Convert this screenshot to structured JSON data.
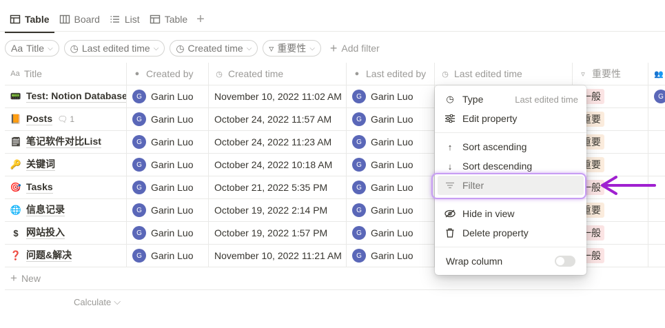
{
  "views": {
    "tabs": [
      {
        "label": "Table",
        "icon": "table-icon",
        "active": true
      },
      {
        "label": "Board",
        "icon": "board-icon",
        "active": false
      },
      {
        "label": "List",
        "icon": "list-icon",
        "active": false
      },
      {
        "label": "Table",
        "icon": "table-icon",
        "active": false
      }
    ],
    "add_label": "+"
  },
  "filters": {
    "chips": [
      {
        "icon_text": "Aa",
        "label": "Title"
      },
      {
        "icon_text": "◷",
        "label": "Last edited time"
      },
      {
        "icon_text": "◷",
        "label": "Created time"
      },
      {
        "icon_text": "▿",
        "label": "重要性"
      }
    ],
    "add_filter_label": "Add filter"
  },
  "table": {
    "columns": [
      {
        "icon_text": "Aa",
        "label": "Title"
      },
      {
        "icon_text": "●",
        "label": "Created by"
      },
      {
        "icon_text": "◷",
        "label": "Created time"
      },
      {
        "icon_text": "●",
        "label": "Last edited by"
      },
      {
        "icon_text": "◷",
        "label": "Last edited time"
      },
      {
        "icon_text": "▿",
        "label": "重要性"
      },
      {
        "icon_text": "👥",
        "label": ""
      }
    ],
    "rows": [
      {
        "icon": "📟",
        "title": "Test: Notion Database",
        "comments": "",
        "created_by": "Garin Luo",
        "created_time": "November 10, 2022 11:02 AM",
        "last_edited_by": "Garin Luo",
        "importance": "一般",
        "importance_color": "red",
        "extra_avatar": "G"
      },
      {
        "icon": "📙",
        "title": "Posts",
        "comments": "1",
        "created_by": "Garin Luo",
        "created_time": "October 24, 2022 11:57 AM",
        "last_edited_by": "Garin Luo",
        "importance": "重要",
        "importance_color": "orange",
        "extra_avatar": ""
      },
      {
        "icon": "🗒",
        "title": "笔记软件对比List",
        "comments": "",
        "created_by": "Garin Luo",
        "created_time": "October 24, 2022 11:23 AM",
        "last_edited_by": "Garin Luo",
        "importance": "重要",
        "importance_color": "orange",
        "extra_avatar": ""
      },
      {
        "icon": "🔑",
        "title": "关键词",
        "comments": "",
        "created_by": "Garin Luo",
        "created_time": "October 24, 2022 10:18 AM",
        "last_edited_by": "Garin Luo",
        "importance": "重要",
        "importance_color": "orange",
        "extra_avatar": ""
      },
      {
        "icon": "🎯",
        "title": "Tasks",
        "comments": "",
        "created_by": "Garin Luo",
        "created_time": "October 21, 2022 5:35 PM",
        "last_edited_by": "Garin Luo",
        "importance": "一般",
        "importance_color": "red",
        "extra_avatar": ""
      },
      {
        "icon": "🌐",
        "title": "信息记录",
        "comments": "",
        "created_by": "Garin Luo",
        "created_time": "October 19, 2022 2:14 PM",
        "last_edited_by": "Garin Luo",
        "importance": "重要",
        "importance_color": "orange",
        "extra_avatar": ""
      },
      {
        "icon": "$",
        "title": "网站投入",
        "comments": "",
        "created_by": "Garin Luo",
        "created_time": "October 19, 2022 1:57 PM",
        "last_edited_by": "Garin Luo",
        "importance": "一般",
        "importance_color": "red",
        "extra_avatar": ""
      },
      {
        "icon": "❓",
        "title": "问题&解决",
        "comments": "",
        "created_by": "Garin Luo",
        "created_time": "November 10, 2022 11:21 AM",
        "last_edited_by": "Garin Luo",
        "importance": "一般",
        "importance_color": "red",
        "extra_avatar": ""
      }
    ],
    "avatar_initial": "G",
    "new_label": "New",
    "calculate_label": "Calculate"
  },
  "menu": {
    "items": [
      {
        "label": "Type",
        "hint": "Last edited time",
        "icon": "clock-icon"
      },
      {
        "label": "Edit property",
        "hint": "",
        "icon": "sliders-icon"
      },
      {
        "label": "Sort ascending",
        "hint": "",
        "icon": "arrow-up-icon"
      },
      {
        "label": "Sort descending",
        "hint": "",
        "icon": "arrow-down-icon"
      },
      {
        "label": "Filter",
        "hint": "",
        "icon": "filter-icon"
      },
      {
        "label": "Hide in view",
        "hint": "",
        "icon": "eye-off-icon"
      },
      {
        "label": "Delete property",
        "hint": "",
        "icon": "trash-icon"
      }
    ],
    "wrap_label": "Wrap column",
    "wrap_enabled": false
  },
  "annotation": {
    "highlight_color": "#c79df3",
    "arrow_color": "#a020d0"
  }
}
